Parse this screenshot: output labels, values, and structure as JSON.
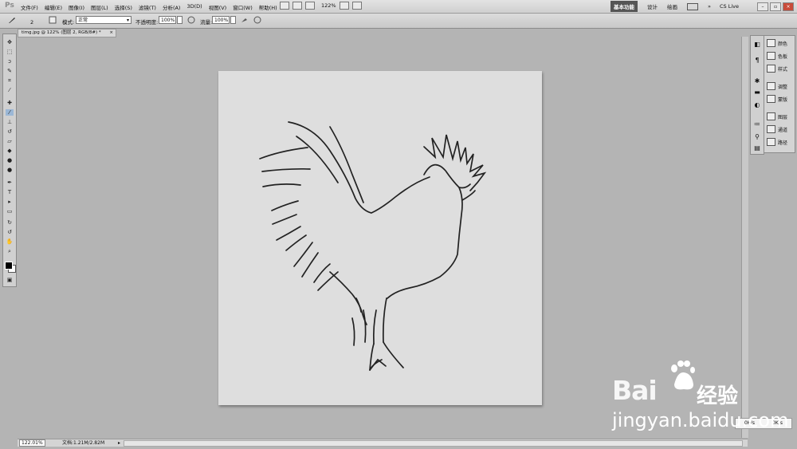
{
  "app": {
    "logo": "Ps"
  },
  "menu": [
    "文件(F)",
    "编辑(E)",
    "图像(I)",
    "图层(L)",
    "选择(S)",
    "滤镜(T)",
    "分析(A)",
    "3D(D)",
    "视图(V)",
    "窗口(W)",
    "帮助(H)"
  ],
  "menu_toolbar": {
    "zoom": "122%"
  },
  "workspaces": {
    "active": "基本功能",
    "items": [
      "设计",
      "绘画"
    ],
    "more": "»"
  },
  "cs_live": "CS Live",
  "options": {
    "brush_size": "2",
    "mode_label": "模式:",
    "mode_value": "正常",
    "opacity_label": "不透明度:",
    "opacity_value": "100%",
    "flow_label": "流量:",
    "flow_value": "100%"
  },
  "document": {
    "tab_title": "timg.jpg @ 122% (图层 2, RGB/8#) *",
    "close": "×"
  },
  "status": {
    "zoom": "122.01%",
    "doc_info": "文档:1.21M/2.82M"
  },
  "panels": {
    "group1": [
      "颜色",
      "色板",
      "样式"
    ],
    "group2": [
      "调整",
      "蒙版"
    ],
    "group3": [
      "图层",
      "通道",
      "路径"
    ]
  },
  "net_monitor": {
    "up": "0K/s",
    "down": "0K/s"
  },
  "watermark": {
    "brand": "Bai",
    "brand2": "经验",
    "url": "jingyan.baidu.com"
  },
  "colors": {
    "fg": "#000000",
    "bg": "#ffffff",
    "canvas": "#dedede",
    "workspace": "#b4b4b4"
  }
}
